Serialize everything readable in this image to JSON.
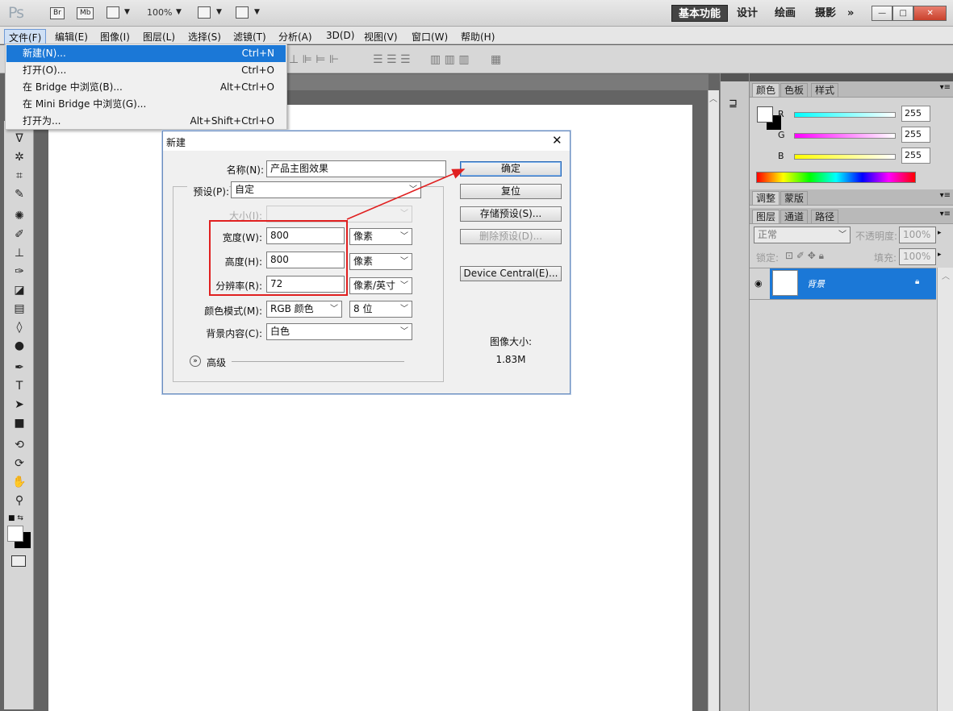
{
  "appbar": {
    "logo": "Ps",
    "bridge": "Br",
    "minibridge": "Mb",
    "zoom": "100%",
    "workspaces": [
      "基本功能",
      "设计",
      "绘画",
      "摄影"
    ],
    "more": "»"
  },
  "menubar": [
    "文件(F)",
    "编辑(E)",
    "图像(I)",
    "图层(L)",
    "选择(S)",
    "滤镜(T)",
    "分析(A)",
    "3D(D)",
    "视图(V)",
    "窗口(W)",
    "帮助(H)"
  ],
  "file_menu": [
    {
      "label": "新建(N)...",
      "shortcut": "Ctrl+N"
    },
    {
      "label": "打开(O)...",
      "shortcut": "Ctrl+O"
    },
    {
      "label": "在 Bridge 中浏览(B)...",
      "shortcut": "Alt+Ctrl+O"
    },
    {
      "label": "在 Mini Bridge 中浏览(G)...",
      "shortcut": ""
    },
    {
      "label": "打开为...",
      "shortcut": "Alt+Shift+Ctrl+O"
    }
  ],
  "dialog": {
    "title": "新建",
    "name_label": "名称(N):",
    "name_value": "产品主图效果",
    "preset_label": "预设(P):",
    "preset_value": "自定",
    "size_label": "大小(I):",
    "width_label": "宽度(W):",
    "width_value": "800",
    "width_unit": "像素",
    "height_label": "高度(H):",
    "height_value": "800",
    "height_unit": "像素",
    "resolution_label": "分辨率(R):",
    "resolution_value": "72",
    "resolution_unit": "像素/英寸",
    "color_mode_label": "颜色模式(M):",
    "color_mode_value": "RGB 颜色",
    "bit_depth": "8 位",
    "bg_label": "背景内容(C):",
    "bg_value": "白色",
    "advanced": "高级",
    "ok": "确定",
    "reset": "复位",
    "save_preset": "存储预设(S)...",
    "delete_preset": "删除预设(D)...",
    "device_central": "Device Central(E)...",
    "image_size_label": "图像大小:",
    "image_size_value": "1.83M",
    "annotation_color": "#e02020"
  },
  "color_panel": {
    "tabs": [
      "颜色",
      "色板",
      "样式"
    ],
    "r_label": "R",
    "r": "255",
    "g_label": "G",
    "g": "255",
    "b_label": "B",
    "b": "255"
  },
  "adjust_panel": {
    "tabs": [
      "调整",
      "蒙版"
    ]
  },
  "layers_panel": {
    "tabs": [
      "图层",
      "通道",
      "路径"
    ],
    "blend_mode": "正常",
    "opacity_label": "不透明度:",
    "opacity": "100%",
    "lock_label": "锁定:",
    "fill_label": "填充:",
    "fill": "100%",
    "layer_name": "背景"
  }
}
